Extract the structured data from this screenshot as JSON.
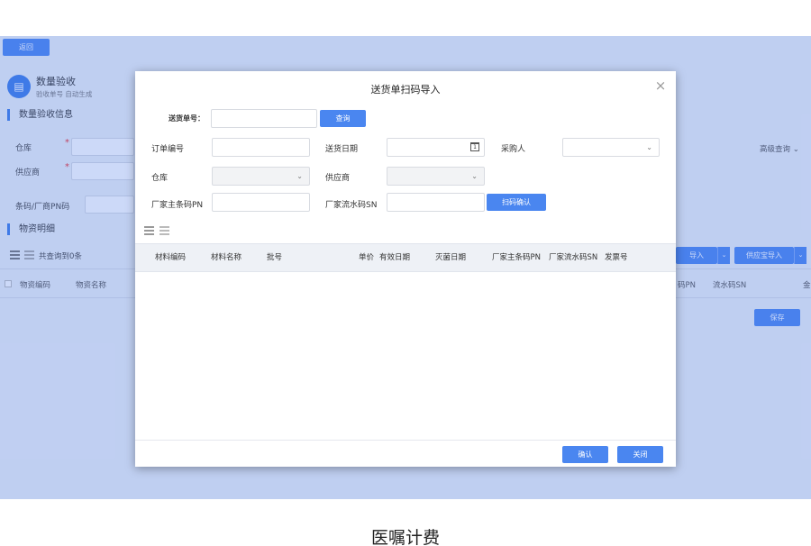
{
  "background": {
    "back_button": "返回",
    "header_icon": "document-icon",
    "title": "数量验收",
    "subtitle": "验收单号 自动生成",
    "section_info": "数量验收信息",
    "warehouse_label": "仓库",
    "supplier_label": "供应商",
    "required_mark": "*",
    "barcode_label": "条码/厂商PN码",
    "section_detail": "物资明细",
    "query_count": "共查询到0条",
    "advanced_query": "高级查询",
    "advanced_caret": "⌄",
    "import_button": "导入",
    "supplier_import_button": "供应宝导入",
    "dropdown_caret": "⌄",
    "columns": [
      "物资编码",
      "物资名称",
      "码PN",
      "流水码SN",
      "金"
    ],
    "save_button": "保存"
  },
  "modal": {
    "title": "送货单扫码导入",
    "close": "×",
    "delivery_no_label": "送货单号：",
    "query_button": "查询",
    "order_no_label": "订单编号",
    "delivery_date_label": "送货日期",
    "calendar_glyph": "1",
    "purchaser_label": "采购人",
    "warehouse_label": "仓库",
    "supplier_label": "供应商",
    "caret": "⌄",
    "pn_label": "厂家主条码PN",
    "sn_label": "厂家流水码SN",
    "scan_confirm_button": "扫码确认",
    "table_columns": [
      "材料编码",
      "材料名称",
      "批号",
      "单价",
      "有效日期",
      "灭菌日期",
      "厂家主条码PN",
      "厂家流水码SN",
      "发票号"
    ],
    "confirm_button": "确认",
    "close_button": "关闭"
  },
  "caption": "医嘱计费"
}
